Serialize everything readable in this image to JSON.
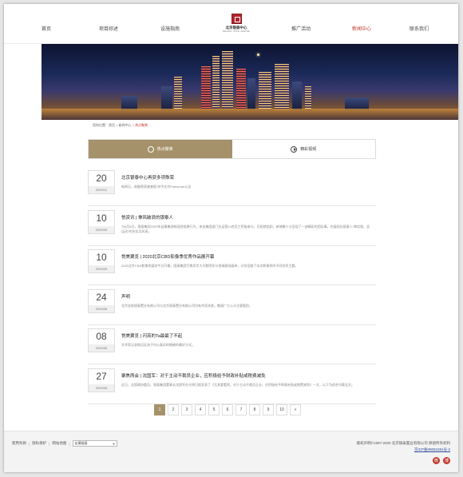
{
  "nav": {
    "items": [
      "首页",
      "项目综述",
      "设施指南",
      "推广活动",
      "新闻中心",
      "联系我们"
    ],
    "active": "新闻中心",
    "logo_cn": "北京银泰中心",
    "logo_en": "BEIJING YINTAI CENTRE"
  },
  "breadcrumb": {
    "prefix": "您的位置：",
    "home": "首页",
    "sep": " > ",
    "section": "新闻中心",
    "current": "热点聚焦"
  },
  "tabs": [
    "热点聚焦",
    "精彩视频"
  ],
  "news": [
    {
      "day": "20",
      "ym": "2020/11",
      "title": "北京银泰中心再获多项殊荣",
      "desc": "新闻记，继融荣获美誉国 授予北京Parksmart认证"
    },
    {
      "day": "10",
      "ym": "2020/09",
      "title": "悦资讯 | 秉风破浪的银泰人",
      "desc": "与8月8日，银泰集团2020年益事集创新园团相邀行为，来自集团部门业运营10名员工积极参与，历程就组织。新骑集十分呈现了一部精彩的团队事。也展现出银泰人“做实践、显运动”的充实活风采。"
    },
    {
      "day": "10",
      "ym": "2020/09",
      "title": "悦美翼览 | 2020北京CBD影像季优秀作品展开幕",
      "desc": "2020北京CBD影像季展览今日开幕，国泰集团写景风华大光影院形与他瑞赛创展来，分别呈献了本次影像季的不同优秀主题。"
    },
    {
      "day": "24",
      "ym": "2020/06",
      "title": "声明",
      "desc": "北京金航银泰置业有限公司与北京国泰置业有限公司均有共同关联。敬请广大公众注意甄别。"
    },
    {
      "day": "08",
      "ym": "2020/06",
      "title": "悦美翼览 | 闪亮的Ta最最了不起",
      "desc": "艺术家记录和见证孩子内心真实的情感的最好方式。"
    },
    {
      "day": "27",
      "ym": "2020/05",
      "title": "聚焦两会 | 沈国军：对于主动不裁员企业，应积极给予财政补贴或税费减免",
      "desc": "近日，全国政协委员、银泰集团董事长沈国军在光明日报发表了《尤其要看到，对于主动不裁员企业，应积极给予财政补贴或税费减免》一文，以下为综合刊载全文。"
    }
  ],
  "pagination": [
    "1",
    "2",
    "3",
    "4",
    "5",
    "6",
    "7",
    "8",
    "9",
    "10",
    "»"
  ],
  "pagination_active": "1",
  "footer": {
    "links": [
      "使用条款",
      "隐私保护",
      "网站地图"
    ],
    "select_value": "友情链接",
    "copyright": "版权声明©1997-2020 北京银泰置业有限公司 保留所有权利",
    "icp": "京ICP备09051591号-2",
    "social": [
      "微",
      "博"
    ]
  },
  "colors": {
    "accent": "#a5926a",
    "active_nav": "#c0392b",
    "brand_red": "#b0252c"
  }
}
